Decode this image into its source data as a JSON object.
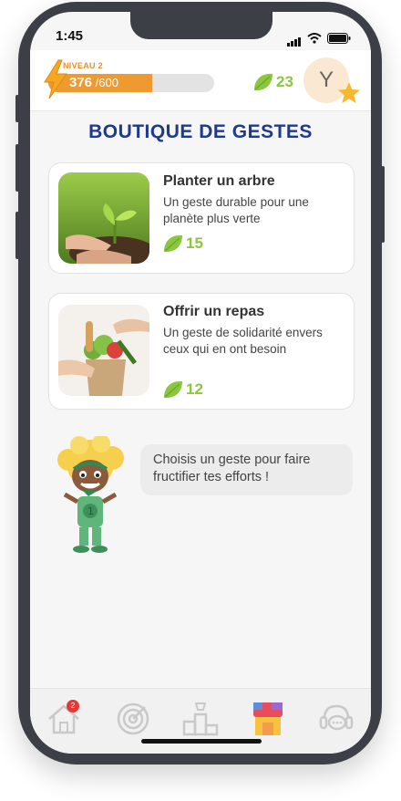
{
  "status_bar": {
    "time": "1:45"
  },
  "header": {
    "level_label": "NIVEAU 2",
    "xp_current": "376",
    "xp_max": "/600",
    "xp_progress": 0.627,
    "leaves": "23",
    "avatar_letter": "Y"
  },
  "page": {
    "title": "BOUTIQUE DE GESTES"
  },
  "items": [
    {
      "title": "Planter un arbre",
      "description": "Un geste durable pour une planète plus verte",
      "cost": "15"
    },
    {
      "title": "Offrir un repas",
      "description": "Un geste de solidarité envers ceux qui en ont besoin",
      "cost": "12"
    }
  ],
  "mascot_message": "Choisis un geste pour faire fructifier tes efforts !",
  "tabbar": {
    "home_badge": "2"
  },
  "colors": {
    "accent_orange": "#ef9a31",
    "leaf_green": "#8cc63f",
    "title_blue": "#1e3a8a",
    "badge_red": "#e53935"
  }
}
